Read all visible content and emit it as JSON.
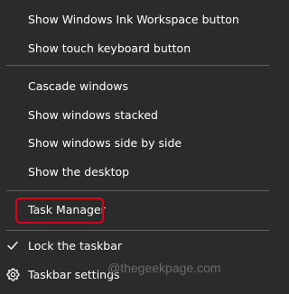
{
  "menu": {
    "items": [
      {
        "label": "Show Windows Ink Workspace button"
      },
      {
        "label": "Show touch keyboard button"
      },
      {
        "label": "Cascade windows"
      },
      {
        "label": "Show windows stacked"
      },
      {
        "label": "Show windows side by side"
      },
      {
        "label": "Show the desktop"
      },
      {
        "label": "Task Manager"
      },
      {
        "label": "Lock the taskbar",
        "icon": "checkmark-icon"
      },
      {
        "label": "Taskbar settings",
        "icon": "gear-icon"
      }
    ]
  },
  "watermark": "@thegeekpage.com",
  "colors": {
    "background": "#2b2b2b",
    "separator": "#5e5e5e",
    "highlight": "#e00016",
    "text": "#ffffff"
  }
}
